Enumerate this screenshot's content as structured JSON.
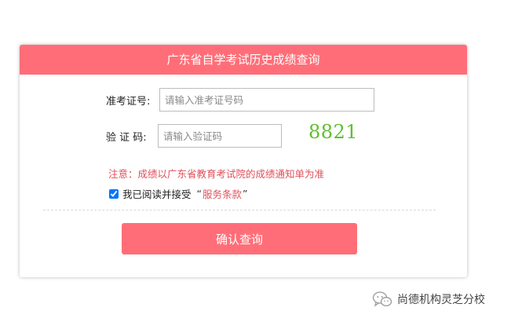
{
  "theme": {
    "accent": "#ff6e78",
    "notice_color": "#e0505a",
    "captcha_color": "#5fbf2c"
  },
  "header": {
    "title": "广东省自学考试历史成绩查询"
  },
  "form": {
    "ticket_label": "准考证号:",
    "ticket_placeholder": "请输入准考证号码",
    "ticket_value": "",
    "code_label": "验 证 码:",
    "code_placeholder": "请输入验证码",
    "code_value": "",
    "captcha_text": "8821",
    "notice": "注意：成绩以广东省教育考试院的成绩通知单为准",
    "agree_prefix": "我已阅读并接受",
    "quote_open": "“",
    "terms_link": "服务条款",
    "quote_close": "”",
    "agree_checked": true,
    "submit_label": "确认查询"
  },
  "watermark": {
    "icon": "wechat-icon",
    "text": "尚德机构灵芝分校"
  }
}
